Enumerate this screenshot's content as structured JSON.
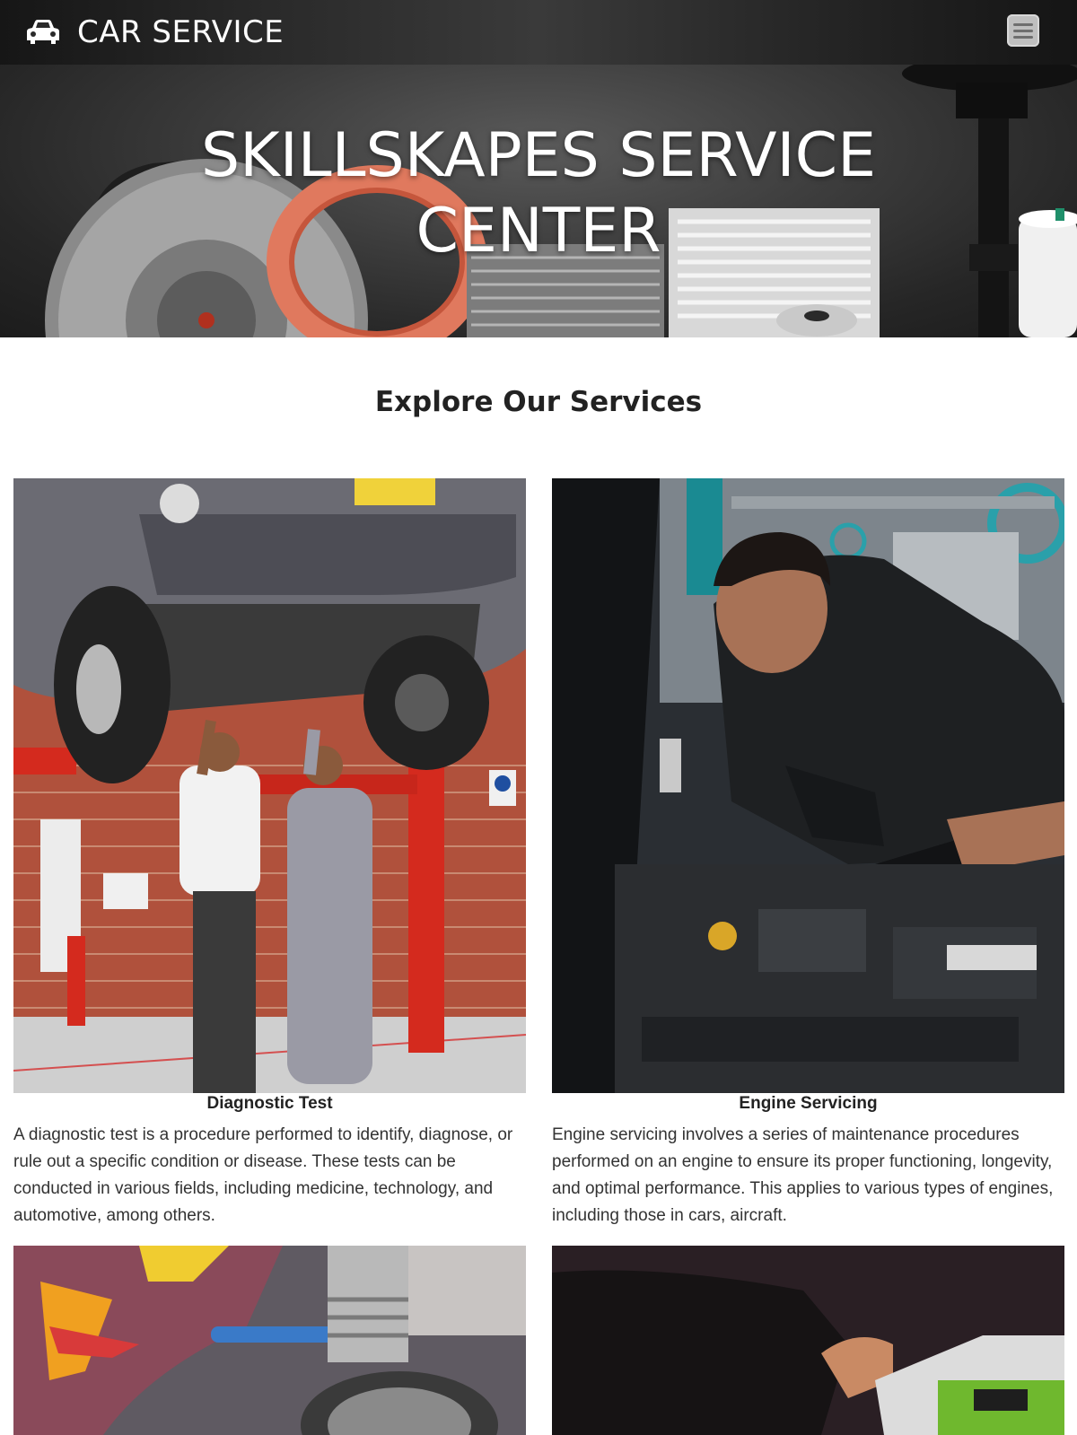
{
  "navbar": {
    "brand_icon": "car-icon",
    "brand_text": "CAR SERVICE",
    "menu_icon": "hamburger-menu-icon"
  },
  "hero": {
    "title": "SKILLSKAPES SERVICE CENTER"
  },
  "services": {
    "heading": "Explore Our Services",
    "items": [
      {
        "name": "Diagnostic Test",
        "description": "A diagnostic test is a procedure performed to identify, diagnose, or rule out a specific condition or disease. These tests can be conducted in various fields, including medicine, technology, and automotive, among others."
      },
      {
        "name": "Engine Servicing",
        "description": "Engine servicing involves a series of maintenance procedures performed on an engine to ensure its proper functioning, longevity, and optimal performance. This applies to various types of engines, including those in cars, aircraft."
      }
    ]
  },
  "colors": {
    "navbar_bg": "#2a2a2a",
    "hero_bg": "#3d3d3d",
    "text_dark": "#222222",
    "white": "#ffffff"
  }
}
